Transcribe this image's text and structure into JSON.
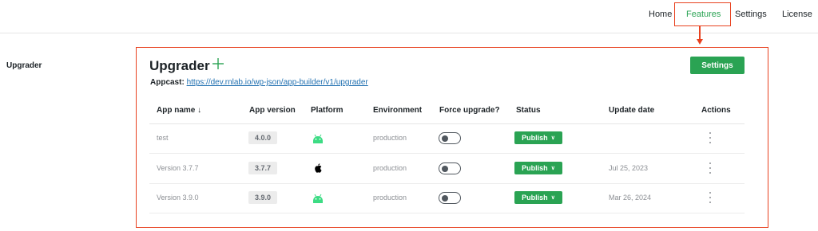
{
  "nav": {
    "items": [
      {
        "label": "Home"
      },
      {
        "label": "Features",
        "active": true
      },
      {
        "label": "Settings"
      },
      {
        "label": "License"
      }
    ]
  },
  "section_label": "Upgrader",
  "panel": {
    "title": "Upgrader",
    "add_icon": "plus-icon",
    "settings_label": "Settings",
    "appcast_label": "Appcast:",
    "appcast_url": "https://dev.rnlab.io/wp-json/app-builder/v1/upgrader"
  },
  "table": {
    "columns": [
      "App name ↓",
      "App version",
      "Platform",
      "Environment",
      "Force upgrade?",
      "Status",
      "Update date",
      "Actions"
    ],
    "rows": [
      {
        "name": "test",
        "version": "4.0.0",
        "platform": "android-icon",
        "environment": "production",
        "force_upgrade": false,
        "status": "Publish",
        "update_date": ""
      },
      {
        "name": "Version 3.7.7",
        "version": "3.7.7",
        "platform": "apple-icon",
        "environment": "production",
        "force_upgrade": false,
        "status": "Publish",
        "update_date": "Jul 25, 2023"
      },
      {
        "name": "Version 3.9.0",
        "version": "3.9.0",
        "platform": "android-icon",
        "environment": "production",
        "force_upgrade": false,
        "status": "Publish",
        "update_date": "Mar 26, 2024"
      }
    ]
  },
  "colors": {
    "accent": "#2aa353",
    "annotation": "#e8411f",
    "link": "#2271b1",
    "android": "#3ddc84"
  }
}
